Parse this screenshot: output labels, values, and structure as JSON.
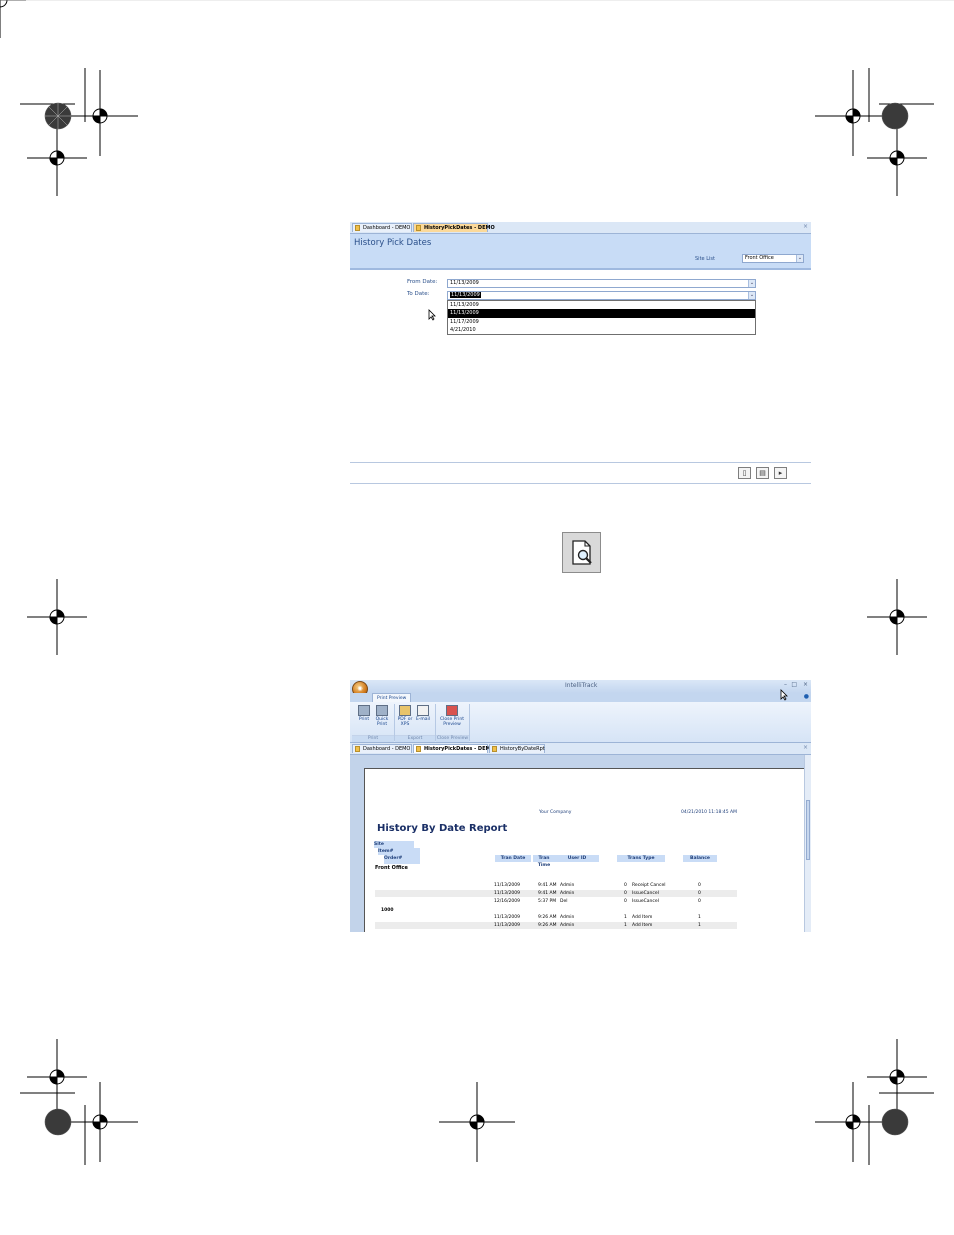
{
  "pick_dates": {
    "tabs": [
      {
        "label": "Dashboard - DEMO",
        "active": false
      },
      {
        "label": "HistoryPickDates - DEMO",
        "active": true
      }
    ],
    "title": "History Pick Dates",
    "site_label": "Site List",
    "site_value": "Front Office",
    "from_label": "From Date:",
    "from_value": "11/13/2009",
    "to_label": "To Date:",
    "to_value": "11/13/2009",
    "options": [
      "11/13/2009",
      "11/13/2009",
      "11/17/2009",
      "4/21/2010"
    ],
    "selected_option_index": 1
  },
  "print_preview": {
    "app_title": "IntelliTrack",
    "ribbon_tab": "Print Preview",
    "buttons": [
      {
        "label": "Print",
        "group": "Print"
      },
      {
        "label": "Quick Print",
        "group": "Print"
      },
      {
        "label": "PDF or XPS",
        "group": "Export"
      },
      {
        "label": "E-mail",
        "group": "Export"
      },
      {
        "label": "Close Print Preview",
        "group": "Close Preview"
      }
    ],
    "groups": [
      "Print",
      "Export",
      "Close Preview"
    ],
    "doc_tabs": [
      {
        "label": "Dashboard - DEMO",
        "active": false
      },
      {
        "label": "HistoryPickDates - DEMO",
        "active": true
      },
      {
        "label": "HistoryByDateRpt",
        "active": false
      }
    ],
    "report": {
      "company": "Your Company",
      "timestamp": "04/21/2010 11:18:45 AM",
      "title": "History By Date Report",
      "group_site": "Site",
      "group_item": "Item#",
      "group_subitem": "Order#",
      "columns": [
        "Tran Date",
        "Tran Time",
        "User ID",
        "Trans Type",
        "Balance"
      ],
      "site_name": "Front Office",
      "rows": [
        {
          "date": "11/13/2009",
          "time": "9:41 AM",
          "user": "Admin",
          "qty": "0",
          "type": "Receipt Cancel",
          "balance": "0"
        },
        {
          "date": "11/13/2009",
          "time": "9:41 AM",
          "user": "Admin",
          "qty": "0",
          "type": "IssueCancel",
          "balance": "0"
        },
        {
          "date": "12/16/2009",
          "time": "5:37 PM",
          "user": "Del",
          "qty": "0",
          "type": "IssueCancel",
          "balance": "0"
        }
      ],
      "item_group": "1000",
      "rows2": [
        {
          "date": "11/13/2009",
          "time": "9:26 AM",
          "user": "Admin",
          "qty": "1",
          "type": "Add Item",
          "balance": "1"
        },
        {
          "date": "11/13/2009",
          "time": "9:26 AM",
          "user": "Admin",
          "qty": "1",
          "type": "Add Item",
          "balance": "1"
        }
      ]
    }
  }
}
